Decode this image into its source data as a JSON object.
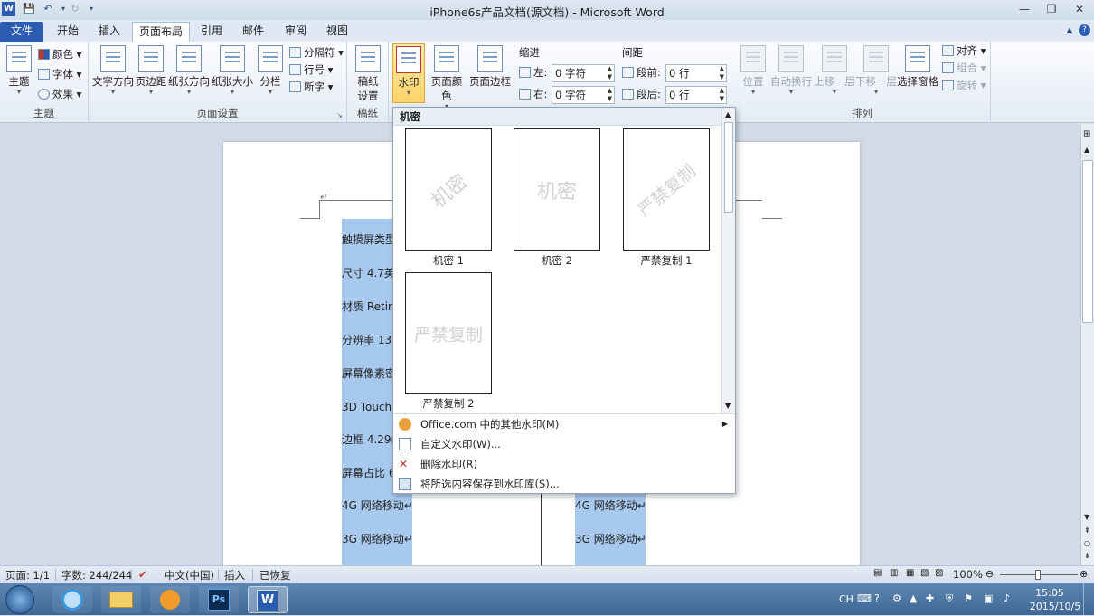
{
  "window": {
    "title": "iPhone6s产品文档(源文档) - Microsoft Word"
  },
  "tabs": [
    {
      "label": "文件"
    },
    {
      "label": "开始"
    },
    {
      "label": "插入"
    },
    {
      "label": "页面布局"
    },
    {
      "label": "引用"
    },
    {
      "label": "邮件"
    },
    {
      "label": "审阅"
    },
    {
      "label": "视图"
    }
  ],
  "ribbon": {
    "theme": {
      "label": "主题",
      "btn": "主题",
      "colors": "颜色",
      "fonts": "字体",
      "effects": "效果"
    },
    "page_setup": {
      "label": "页面设置",
      "text_dir": "文字方向",
      "margins": "页边距",
      "orientation": "纸张方向",
      "size": "纸张大小",
      "columns": "分栏",
      "breaks": "分隔符",
      "line_numbers": "行号",
      "hyphenation": "断字"
    },
    "draft": {
      "label": "稿纸",
      "btn1": "稿纸",
      "btn2": "设置"
    },
    "background": {
      "watermark": "水印",
      "page_color": "页面颜色",
      "page_borders": "页面边框"
    },
    "paragraph": {
      "indent_label": "缩进",
      "left_label": "左:",
      "left_value": "0 字符",
      "right_label": "右:",
      "right_value": "0 字符",
      "spacing_label": "间距",
      "before_label": "段前:",
      "before_value": "0 行",
      "after_label": "段后:",
      "after_value": "0 行"
    },
    "arrange": {
      "label": "排列",
      "position": "位置",
      "wrap": "自动换行",
      "bring_forward": "上移一层",
      "send_backward": "下移一层",
      "selection_pane": "选择窗格",
      "align": "对齐",
      "group": "组合",
      "rotate": "旋转"
    }
  },
  "document": {
    "left_rows": [
      "触摸屏类型",
      "尺寸 4.7英",
      "材质 Retin",
      "分辨率 133",
      "屏幕像素密",
      "3D Touch 屏",
      "边框 4.29m",
      "屏幕占比 6",
      "4G 网络移动↵",
      "3G 网络移动↵"
    ],
    "right_rows": [
      "4G 网络移动↵",
      "3G 网络移动↵"
    ]
  },
  "watermark_panel": {
    "section": "机密",
    "items": [
      {
        "caption": "机密 1",
        "text": "机密",
        "style": "diagonal"
      },
      {
        "caption": "机密 2",
        "text": "机密",
        "style": "horizontal"
      },
      {
        "caption": "严禁复制 1",
        "text": "严禁复制",
        "style": "diagonal"
      },
      {
        "caption": "严禁复制 2",
        "text": "严禁复制",
        "style": "horizontal"
      }
    ],
    "menu": [
      {
        "label": "Office.com 中的其他水印(M)",
        "submenu": true
      },
      {
        "label": "自定义水印(W)..."
      },
      {
        "label": "删除水印(R)"
      },
      {
        "label": "将所选内容保存到水印库(S)..."
      }
    ]
  },
  "statusbar": {
    "page": "页面: 1/1",
    "words": "字数: 244/244",
    "language": "中文(中国)",
    "insert": "插入",
    "restored": "已恢复",
    "zoom": "100%"
  },
  "taskbar": {
    "ime": "CH",
    "time": "15:05",
    "date": "2015/10/5"
  },
  "colors": {
    "accent": "#2a5cb1",
    "highlight": "#a8c9ee",
    "taskbar": "#4a74a3"
  }
}
